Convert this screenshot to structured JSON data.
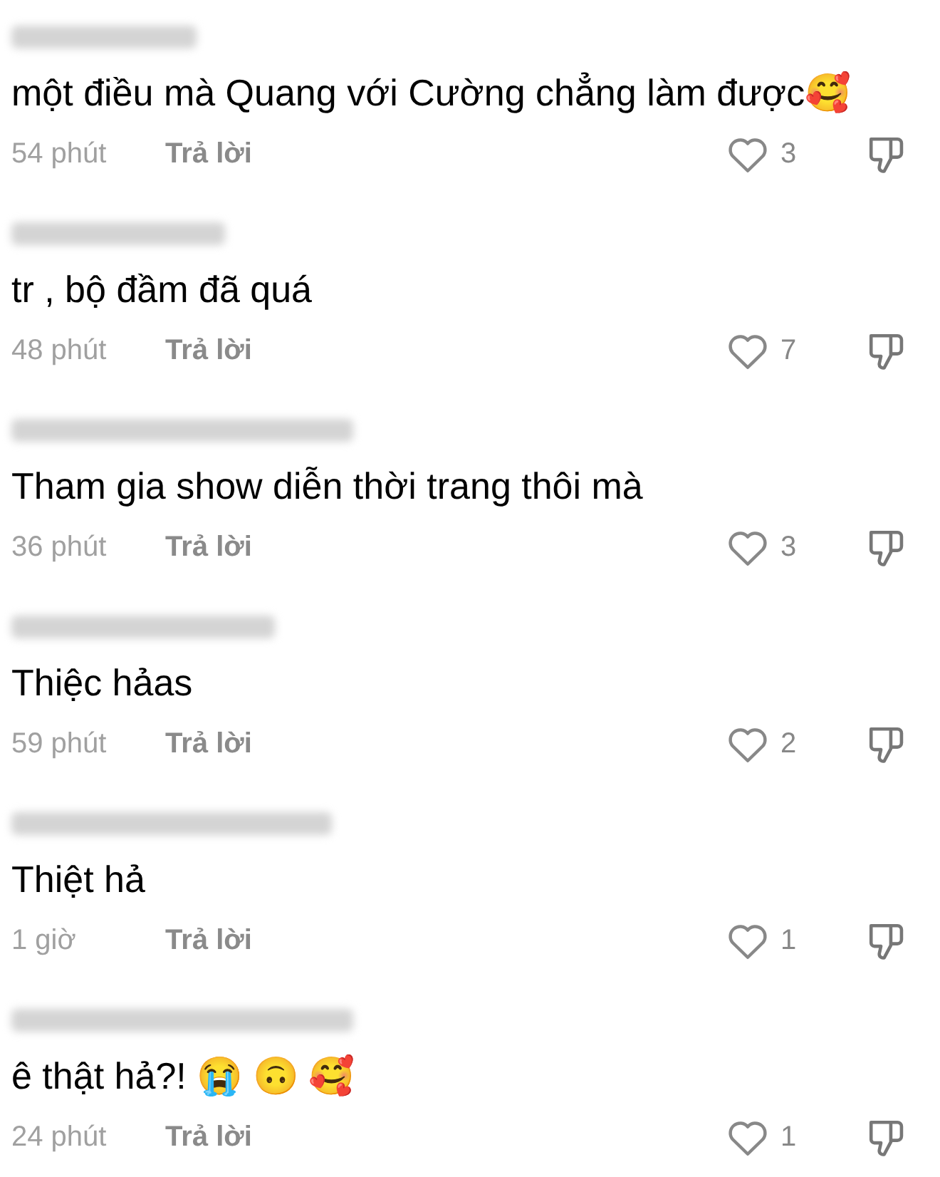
{
  "comments": [
    {
      "text": "một điều mà Quang với Cường chẳng làm được🥰",
      "time": "54 phút",
      "reply": "Trả lời",
      "likes": "3"
    },
    {
      "text": "tr , bộ đầm đã quá",
      "time": "48 phút",
      "reply": "Trả lời",
      "likes": "7"
    },
    {
      "text": "Tham gia show diễn thời trang thôi mà",
      "time": "36 phút",
      "reply": "Trả lời",
      "likes": "3"
    },
    {
      "text": "Thiệc hảas",
      "time": "59 phút",
      "reply": "Trả lời",
      "likes": "2"
    },
    {
      "text": "Thiệt hả",
      "time": "1 giờ",
      "reply": "Trả lời",
      "likes": "1"
    },
    {
      "text": "ê thật hả?! 😭 🙃 🥰",
      "time": "24 phút",
      "reply": "Trả lời",
      "likes": "1"
    }
  ]
}
